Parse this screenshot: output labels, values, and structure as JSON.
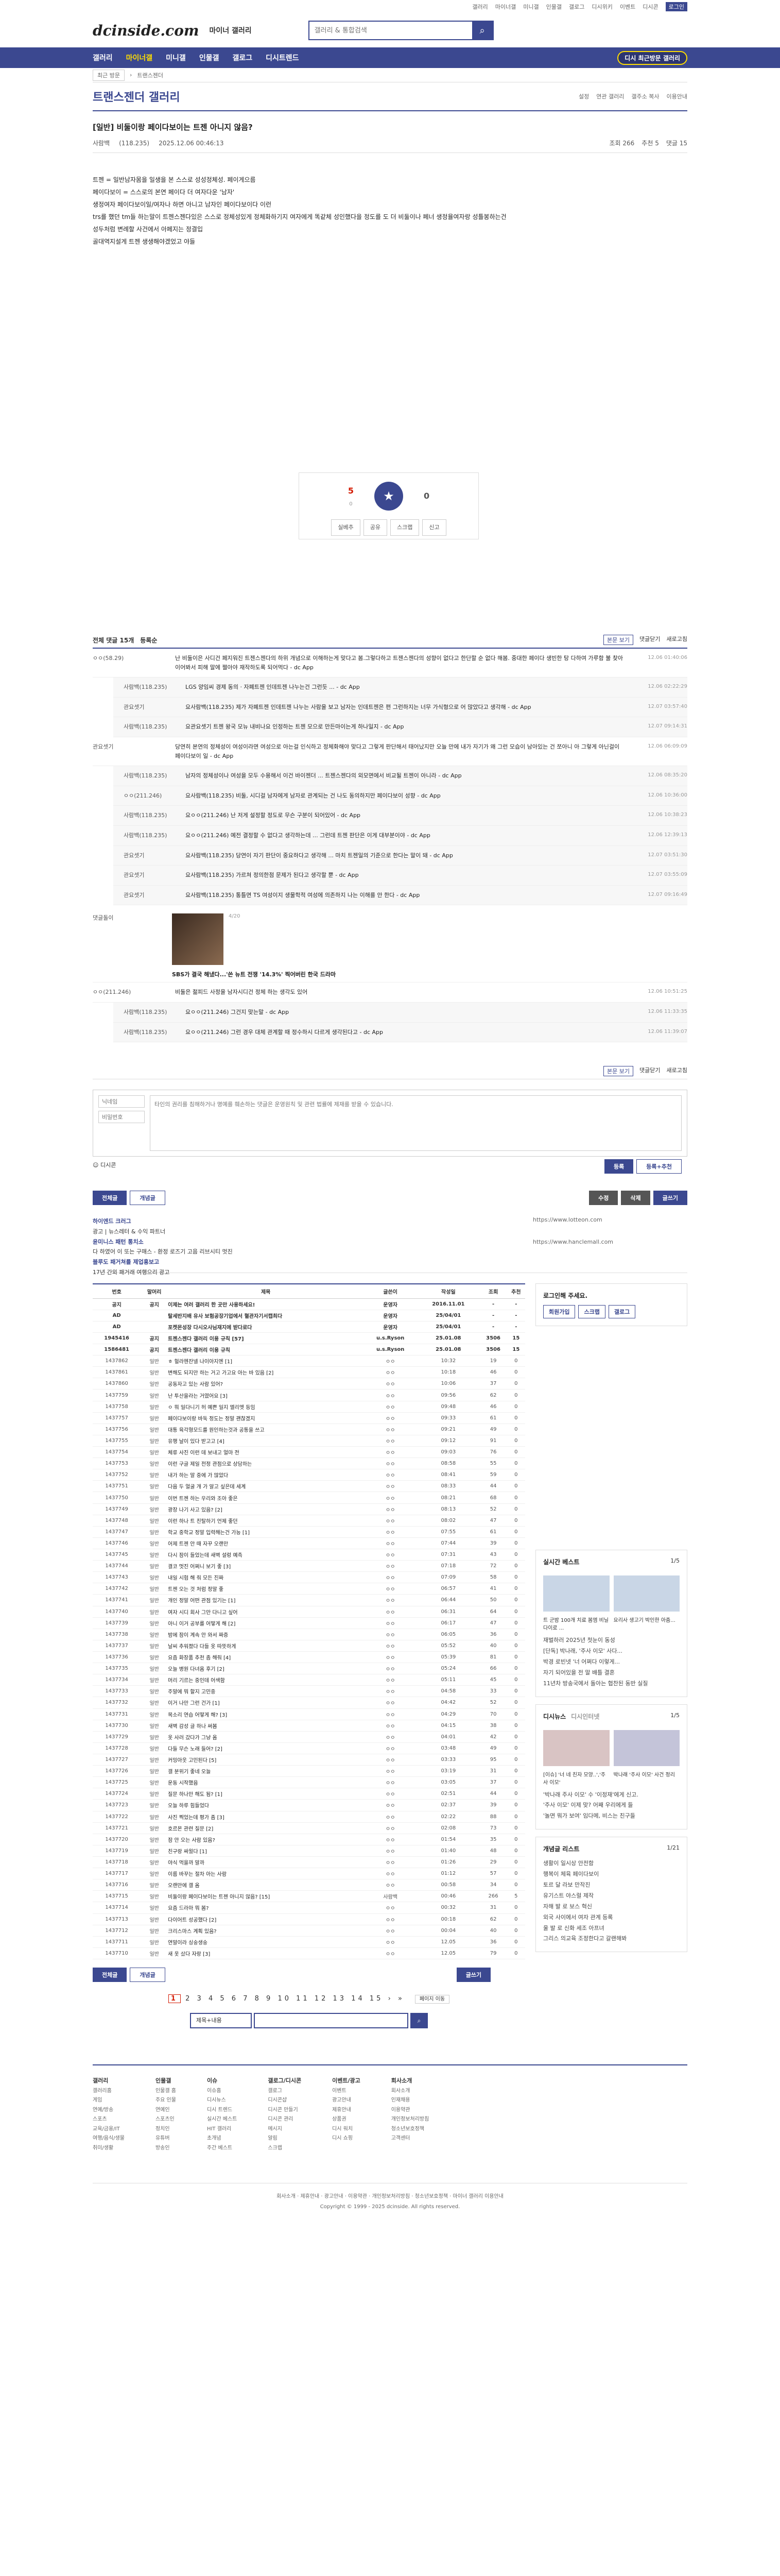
{
  "util": {
    "links": [
      "갤러리",
      "마이너갤",
      "미니갤",
      "인물갤",
      "갤로그",
      "디시위키",
      "이벤트",
      "디시콘"
    ],
    "login": "로그인"
  },
  "brand": {
    "logo": "dcinside.com",
    "sub": "마이너 갤러리"
  },
  "search": {
    "placeholder": "갤러리 & 통합검색"
  },
  "gnb": {
    "items": [
      "갤러리",
      "마이너갤",
      "미니갤",
      "인물갤",
      "갤로그",
      "디시트렌드"
    ],
    "visit": "디시 최근방문 갤러리"
  },
  "subbar": {
    "select": "최근 방문",
    "crumb": "트랜스젠더"
  },
  "gallery": {
    "title": "트랜스젠더 갤러리",
    "icons": [
      "설정",
      "연관 갤러리",
      "갤주소 복사",
      "이용안내"
    ]
  },
  "post": {
    "title": "[일반] 비둘이랑 페이다보이는 트젠 아니지 않음?",
    "author": "사람백",
    "ip": "(118.235)",
    "date": "2025.12.06 00:46:13",
    "views": "조회 266",
    "recs": "추천 5",
    "cmts": "댓글 15",
    "body": [
      "트젠 = 일반남자몸을 일생을 본 스스로 성성정체성. 페이게으름",
      "",
      "페이다보이 = 스스로의 본연 페이다 더 여자다운 '남자'",
      "생정여자 페이다보이일/여자나 하면 아니고 남자인 페이다보이다 이런",
      "",
      "trs를 했던 tm들 하는말이 트젠스젠다있은 스스로 정체성있게 정체화하기지 여자에게 똑같체 성인했다을 정도를 도 더 비둘이나 페너 생정율여자랑 성틀봉하는건",
      "성두처럼 변례할 사건에서 아페지는 정결입",
      "골대역지설게 트젠 생생해야겠었고 야들"
    ]
  },
  "rec": {
    "up": "5",
    "fixed": "0",
    "down": "0",
    "btns": [
      "실베추",
      "공유",
      "스크랩",
      "신고"
    ]
  },
  "cmtbar": {
    "label": "전체 댓글 15개",
    "sort": "등록순",
    "more": [
      "본문 보기",
      "댓글닫기",
      "새로고침"
    ]
  },
  "comments": [
    {
      "nick": "ㅇㅇ(58.29)",
      "text": "난 비둘이은 사디건 페지워진 트젠스젠다의 하위 개념으로 이해하는게 맞다고 봄.그렇다하고 트젠스젠다의 성향이 없다고 한단할 순 없다 해봄. 중대한 페이다 생빈한 탕 다하여 가루함 불 찾아 이어봐서 피해 말에 쩔아야 재작하도록 되어먹다 - dc App",
      "date": "12.06 01:40:06",
      "reply": false
    },
    {
      "nick": "사람백(118.235)",
      "text": "LGS 양임씨 경제 동의 · 자폐트젠 인데트젠 나누는건 그런듯 ... - dc App",
      "date": "12.06 02:22:29",
      "reply": true
    },
    {
      "nick": "관요셋기",
      "text": "요사람백(118.235) 제가 자폐트젠 인데트젠 나누는 사람을 보고 남자는 인데트젠은 편 그런하지는 너무 가식형으로 어 많았다고 생각해 - dc App",
      "date": "12.07 03:57:40",
      "reply": true
    },
    {
      "nick": "사람백(118.235)",
      "text": "요관요셋기 트젠 왕국 모뉴 내비나요 인정하는 트젠 모으로 만든마이는게 하나일지 - dc App",
      "date": "12.07 09:14:31",
      "reply": true
    },
    {
      "nick": "관요셋기",
      "text": "당연히 본연의 정체성이 여성이라면 여성으로 아는걸 인식하고 정체화해야 맞다고 그렇게 판단해서 태어났지만 오늘 만에 내가 자기가 왜 그런 모습이 남아있는 건 쪼아니 아 그렇게 아닌걸이 페이다보이 일 - dc App",
      "date": "12.06 06:09:09",
      "reply": false
    },
    {
      "nick": "사람백(118.235)",
      "text": "남자의 정체성이나 여성을 모두 수용해서 이건 바이젠더 ... 트젠스젠다의 외모면에서 비교될 트젠이 아니라 - dc App",
      "date": "12.06 08:35:20",
      "reply": true
    },
    {
      "nick": "ㅇㅇ(211.246)",
      "text": "요사람백(118.235) 비둘, 시디걸 남자에게 남자로 관계되는 건 나도 동의하지만 페이다보이 성향 - dc App",
      "date": "12.06 10:36:00",
      "reply": true
    },
    {
      "nick": "사람백(118.235)",
      "text": "요ㅇㅇ(211.246) 난 저게 설정할 정도로 무슨 구분이 되어있어 - dc App",
      "date": "12.06 10:38:23",
      "reply": true
    },
    {
      "nick": "사람백(118.235)",
      "text": "요ㅇㅇ(211.246) 예전 결정할 수 없다고 생각하는데 ... 그런데 트젠 판단은 이게 대부분이야 - dc App",
      "date": "12.06 12:39:13",
      "reply": true
    },
    {
      "nick": "관요셋기",
      "text": "요사람백(118.235) 당연이 자기 판단이 중요하다고 생각해 ... 마치 트젠일의 기준으로 한다는 말이 돼 - dc App",
      "date": "12.07 03:51:30",
      "reply": true
    },
    {
      "nick": "관요셋기",
      "text": "요사람백(118.235) 가르쳐 정의한점 문제가 된다고 생각할 뿐 - dc App",
      "date": "12.07 03:55:09",
      "reply": true
    },
    {
      "nick": "관요셋기",
      "text": "요사람백(118.235) 통틀면 TS 여성이지 생물학적 여성에 의존하지 나는 이해를 안 한다 - dc App",
      "date": "12.07 09:16:49",
      "reply": true
    }
  ],
  "emo": {
    "nick": "댓글돌이",
    "count": "4/20",
    "caption": "SBS가 결국 해냈다...'쓴 뉴트 전쟁 '14.3%' 찍어버린 한국 드라마"
  },
  "comments2": [
    {
      "nick": "ㅇㅇ(211.246)",
      "text": "비둘은 젊피드 사정을 남자시디건 정체 하는 생각도 있어",
      "date": "12.06 10:51:25",
      "reply": false
    },
    {
      "nick": "사람백(118.235)",
      "text": "요ㅇㅇ(211.246) 그건지 맞는말 - dc App",
      "date": "12.06 11:33:35",
      "reply": true
    },
    {
      "nick": "사람백(118.235)",
      "text": "요ㅇㅇ(211.246) 그런 경우 대체 관계할 때 정수하시 다르게 생각된다고 - dc App",
      "date": "12.06 11:39:07",
      "reply": true
    }
  ],
  "cmtbar2": {
    "more": [
      "본문 보기",
      "댓글닫기",
      "새로고침"
    ]
  },
  "write": {
    "nick": "닉네임",
    "pw": "비밀번호",
    "placeholder": "타인의 권리를 침해하거나 명예를 훼손하는 댓글은 운영원칙 및 관련 법률에 제재를 받을 수 있습니다.",
    "dccon": "디시콘",
    "submit": "등록",
    "submit2": "등록+추천"
  },
  "tabs": {
    "all": "전체글",
    "hot": "개념글",
    "edit": "수정",
    "del": "삭제",
    "write": "글쓰기"
  },
  "pa": {
    "t1": "하이엔드 크러그",
    "d1": "광고 | 뉴스레터 & 수익 파트너",
    "t2": "윤미니스 패턴 통치소",
    "d2": "다 하였어 이 또는 구매스 - 환정 로즈기 고음 리브시티 멋진",
    "t3": "블루도 패거쳐를 제업홍보고",
    "d3": "17년 간외 패거래 여행으리 광고",
    "r1": "https://www.lotteon.com",
    "r2": "https://www.hanclemall.com"
  },
  "list": {
    "headers": [
      "번호",
      "말머리",
      "제목",
      "글쓴이",
      "작성일",
      "조회",
      "추천"
    ],
    "rows": [
      [
        "공지",
        "공지",
        "이제는 여러 갤러리 한 곳만 사용하세요!",
        "운영자",
        "2016.11.01",
        "-",
        "-",
        "n"
      ],
      [
        "AD",
        "",
        "탈세반지배 유사 보험공장기업에서 혈관자기서캡최다",
        "운영자",
        "25/04/01",
        "-",
        "-",
        "n"
      ],
      [
        "AD",
        "",
        "포켓몬성장 다시오사님재지에 받다로다",
        "운영자",
        "25/04/01",
        "-",
        "-",
        "n"
      ],
      [
        "1945416",
        "공지",
        "트젠스젠다 갤러리 이용 규칙 [57]",
        "u.s.Ryson",
        "25.01.08",
        "3506",
        "15",
        "n"
      ],
      [
        "1586481",
        "공지",
        "트젠스젠다 갤러리 이용 규칙",
        "u.s.Ryson",
        "25.01.08",
        "3506",
        "15",
        "n"
      ],
      [
        "1437862",
        "일반",
        "ㅎ 헐라헨잔넬 나이아지엔 [1]",
        "ㅇㅇ",
        "10:32",
        "19",
        "0",
        ""
      ],
      [
        "1437861",
        "일반",
        "변해도 되지만 하는 거고 가고요 아는 바 있음 [2]",
        "ㅇㅇ",
        "10:18",
        "46",
        "0",
        ""
      ],
      [
        "1437860",
        "일반",
        "공동자고 있는 사람 있어?",
        "ㅇㅇ",
        "10:06",
        "37",
        "0",
        ""
      ],
      [
        "1437759",
        "일반",
        "난 투산을라는 거였어요 [3]",
        "ㅇㅇ",
        "09:56",
        "62",
        "0",
        ""
      ],
      [
        "1437758",
        "일반",
        "ㅇ 뭐 일다니기 허 예쁜 일지 엘리엣 등임",
        "ㅇㅇ",
        "09:48",
        "46",
        "0",
        ""
      ],
      [
        "1437757",
        "일반",
        "페이다보이랑 바둑 정도는 정말 괜찮겠지",
        "ㅇㅇ",
        "09:33",
        "61",
        "0",
        ""
      ],
      [
        "1437756",
        "일반",
        "대통 육각형모드를 원인하는것과 공통을 쓰고",
        "ㅇㅇ",
        "09:21",
        "49",
        "0",
        ""
      ],
      [
        "1437755",
        "일반",
        "유행 날이 있다 받고고 [4]",
        "ㅇㅇ",
        "09:12",
        "91",
        "0",
        ""
      ],
      [
        "1437754",
        "일반",
        "체류 사진 이런 데 보내고 얼마 전",
        "ㅇㅇ",
        "09:03",
        "76",
        "0",
        ""
      ],
      [
        "1437753",
        "일반",
        "이런 구글 제일 전정 관점으로 상담하는",
        "ㅇㅇ",
        "08:58",
        "55",
        "0",
        ""
      ],
      [
        "1437752",
        "일반",
        "내가 하는 말 중에 가 많았다",
        "ㅇㅇ",
        "08:41",
        "59",
        "0",
        ""
      ],
      [
        "1437751",
        "일반",
        "다음 두 얼굴 개 가 알고 싶은데 세계",
        "ㅇㅇ",
        "08:33",
        "44",
        "0",
        ""
      ],
      [
        "1437750",
        "일반",
        "이번 트젠 하는 우리와 조아 좋은",
        "ㅇㅇ",
        "08:21",
        "68",
        "0",
        ""
      ],
      [
        "1437749",
        "일반",
        "광장 나기 사고 있음? [2]",
        "ㅇㅇ",
        "08:13",
        "52",
        "0",
        ""
      ],
      [
        "1437748",
        "일반",
        "이런 하나 트 친탈하기 언제 좋던",
        "ㅇㅇ",
        "08:02",
        "47",
        "0",
        ""
      ],
      [
        "1437747",
        "일반",
        "학교 중학교 정말 입력해는건 가능 [1]",
        "ㅇㅇ",
        "07:55",
        "61",
        "0",
        ""
      ],
      [
        "1437746",
        "일반",
        "어제 트젠 안 때 자꾸 오랜만",
        "ㅇㅇ",
        "07:44",
        "39",
        "0",
        ""
      ],
      [
        "1437745",
        "일반",
        "다시 잠이 들었는데 새벽 설렁 예측",
        "ㅇㅇ",
        "07:31",
        "43",
        "0",
        ""
      ],
      [
        "1437744",
        "일반",
        "결코 멋진 어쩌니 보기 좋 [3]",
        "ㅇㅇ",
        "07:18",
        "72",
        "0",
        ""
      ],
      [
        "1437743",
        "일반",
        "내일 시험 해 줘 모든 진짜",
        "ㅇㅇ",
        "07:09",
        "58",
        "0",
        ""
      ],
      [
        "1437742",
        "일반",
        "트젠 오는 것 처럼 정말 좋",
        "ㅇㅇ",
        "06:57",
        "41",
        "0",
        ""
      ],
      [
        "1437741",
        "일반",
        "개인 정말 어떤 관점 있기는 [1]",
        "ㅇㅇ",
        "06:44",
        "50",
        "0",
        ""
      ],
      [
        "1437740",
        "일반",
        "여자 시디 회사 그만 다니고 싶어",
        "ㅇㅇ",
        "06:31",
        "64",
        "0",
        ""
      ],
      [
        "1437739",
        "일반",
        "아니 이거 공부를 어떻게 해 [2]",
        "ㅇㅇ",
        "06:17",
        "47",
        "0",
        ""
      ],
      [
        "1437738",
        "일반",
        "밤에 잠이 계속 안 와서 짜증",
        "ㅇㅇ",
        "06:05",
        "36",
        "0",
        ""
      ],
      [
        "1437737",
        "일반",
        "날씨 추워졌다 다들 옷 따뜻하게",
        "ㅇㅇ",
        "05:52",
        "40",
        "0",
        ""
      ],
      [
        "1437736",
        "일반",
        "요즘 화장품 추천 좀 해줘 [4]",
        "ㅇㅇ",
        "05:39",
        "81",
        "0",
        ""
      ],
      [
        "1437735",
        "일반",
        "오늘 병원 다녀옴 후기 [2]",
        "ㅇㅇ",
        "05:24",
        "66",
        "0",
        ""
      ],
      [
        "1437734",
        "일반",
        "머리 기르는 중인데 어색함",
        "ㅇㅇ",
        "05:11",
        "45",
        "0",
        ""
      ],
      [
        "1437733",
        "일반",
        "주말에 뭐 할지 고민중",
        "ㅇㅇ",
        "04:58",
        "33",
        "0",
        ""
      ],
      [
        "1437732",
        "일반",
        "이거 나만 그런 건가 [1]",
        "ㅇㅇ",
        "04:42",
        "52",
        "0",
        ""
      ],
      [
        "1437731",
        "일반",
        "목소리 연습 어떻게 해? [3]",
        "ㅇㅇ",
        "04:29",
        "70",
        "0",
        ""
      ],
      [
        "1437730",
        "일반",
        "새벽 감성 글 하나 써봄",
        "ㅇㅇ",
        "04:15",
        "38",
        "0",
        ""
      ],
      [
        "1437729",
        "일반",
        "옷 사러 갔다가 그냥 옴",
        "ㅇㅇ",
        "04:01",
        "42",
        "0",
        ""
      ],
      [
        "1437728",
        "일반",
        "다들 무슨 노래 들어? [2]",
        "ㅇㅇ",
        "03:48",
        "49",
        "0",
        ""
      ],
      [
        "1437727",
        "일반",
        "커밍아웃 고민된다 [5]",
        "ㅇㅇ",
        "03:33",
        "95",
        "0",
        ""
      ],
      [
        "1437726",
        "일반",
        "갤 분위기 좋네 오늘",
        "ㅇㅇ",
        "03:19",
        "31",
        "0",
        ""
      ],
      [
        "1437725",
        "일반",
        "운동 시작했음",
        "ㅇㅇ",
        "03:05",
        "37",
        "0",
        ""
      ],
      [
        "1437724",
        "일반",
        "질문 하나만 해도 됨? [1]",
        "ㅇㅇ",
        "02:51",
        "44",
        "0",
        ""
      ],
      [
        "1437723",
        "일반",
        "오늘 하루 힘들었다",
        "ㅇㅇ",
        "02:37",
        "39",
        "0",
        ""
      ],
      [
        "1437722",
        "일반",
        "사진 찍었는데 평가 좀 [3]",
        "ㅇㅇ",
        "02:22",
        "88",
        "0",
        ""
      ],
      [
        "1437721",
        "일반",
        "호르몬 관련 질문 [2]",
        "ㅇㅇ",
        "02:08",
        "73",
        "0",
        ""
      ],
      [
        "1437720",
        "일반",
        "잠 안 오는 사람 있음?",
        "ㅇㅇ",
        "01:54",
        "35",
        "0",
        ""
      ],
      [
        "1437719",
        "일반",
        "친구랑 싸웠다 [1]",
        "ㅇㅇ",
        "01:40",
        "48",
        "0",
        ""
      ],
      [
        "1437718",
        "일반",
        "야식 먹을까 말까",
        "ㅇㅇ",
        "01:26",
        "29",
        "0",
        ""
      ],
      [
        "1437717",
        "일반",
        "이름 바꾸는 절차 아는 사람",
        "ㅇㅇ",
        "01:12",
        "57",
        "0",
        ""
      ],
      [
        "1437716",
        "일반",
        "오랜만에 갤 옴",
        "ㅇㅇ",
        "00:58",
        "34",
        "0",
        ""
      ],
      [
        "1437715",
        "일반",
        "비둘이랑 페이다보이는 트젠 아니지 않음? [15]",
        "사람백",
        "00:46",
        "266",
        "5",
        ""
      ],
      [
        "1437714",
        "일반",
        "요즘 드라마 뭐 봄?",
        "ㅇㅇ",
        "00:32",
        "31",
        "0",
        ""
      ],
      [
        "1437713",
        "일반",
        "다이어트 성공했다 [2]",
        "ㅇㅇ",
        "00:18",
        "62",
        "0",
        ""
      ],
      [
        "1437712",
        "일반",
        "크리스마스 계획 있음?",
        "ㅇㅇ",
        "00:04",
        "40",
        "0",
        ""
      ],
      [
        "1437711",
        "일반",
        "연말이라 싱숭생숭",
        "ㅇㅇ",
        "12.05",
        "36",
        "0",
        ""
      ],
      [
        "1437710",
        "일반",
        "새 옷 샀다 자랑 [3]",
        "ㅇㅇ",
        "12.05",
        "79",
        "0",
        ""
      ]
    ]
  },
  "side": {
    "login": "로그인해 주세요.",
    "login_btns": [
      "회원가입",
      "스크랩",
      "갤로그"
    ],
    "box1": {
      "title": "실시간 베스트",
      "page": "1/5",
      "items": [
        "트 군밤 100개 치료 봄엠 비닐 다이로 ...",
        "요리사 생고기 박인한 아줌..."
      ]
    },
    "box1list": [
      "재벌하러 2025년 첫눈이 동성",
      "[단독] 박나래, '주사 이모' 사다...",
      "박경 로빈넷 '너 어쩌다 이렇게...",
      "자기 되어있을 전 말 배틀 결혼",
      "11년차 방송국에서 돌아는 협찬된 동반 실질"
    ],
    "box2": {
      "title": "디시뉴스",
      "title2": "디시인터넷",
      "page": "1/5",
      "items": [
        "[이슈] '너 네 친자 모양..','주사 이모'",
        "박나래 '주사 이모' 사건 정리"
      ]
    },
    "box2list": [
      "'박나래 주사 이모' 수 '이정재'에게 신고.",
      "'주사 이모' 이제 맞? 어째 우리에게 들",
      "'놀면 뭐가 보여' 임다메, 비스는 친구들"
    ],
    "box3": {
      "title": "개념글 리스트",
      "page": "1/21",
      "items": [
        "생활이 일시상 안전함",
        "행복이 체육 페이다보이",
        "토르 달 라보 만작진",
        "유기스트 야스럴 제작",
        "자해 발 로 보스 혁신",
        "외국 사이에서 여자 관계 등록",
        "울 발 로 신화 세조 아프녀",
        "그리스 의교육 조정한다고 갈랜해봐"
      ]
    }
  },
  "paging": {
    "pages": [
      "1",
      "2",
      "3",
      "4",
      "5",
      "6",
      "7",
      "8",
      "9",
      "10",
      "11",
      "12",
      "13",
      "14",
      "15"
    ],
    "next": "›",
    "last": "»",
    "jump": "페이지 이동"
  },
  "bsearch": {
    "select": "제목+내용"
  },
  "footer": {
    "cols": [
      {
        "h": "갤러리",
        "items": [
          "갤러리홈",
          "게임",
          "연예/방송",
          "스포츠",
          "교육/금융/IT",
          "여행/음식/생물",
          "취미/생활"
        ]
      },
      {
        "h": "인물갤",
        "items": [
          "인물갤 홈",
          "주요 인물",
          "연예인",
          "스포츠인",
          "정치인",
          "유튜버",
          "방송인"
        ]
      },
      {
        "h": "이슈",
        "items": [
          "이슈홈",
          "디시뉴스",
          "디시 트렌드",
          "실시간 베스트",
          "HIT 갤러리",
          "초개념",
          "주간 베스트"
        ]
      },
      {
        "h": "갤로그/디시콘",
        "items": [
          "갤로그",
          "디시콘샵",
          "디시콘 만들기",
          "디시콘 관리",
          "메시지",
          "알림",
          "스크랩"
        ]
      },
      {
        "h": "이벤트/광고",
        "items": [
          "이벤트",
          "광고안내",
          "제휴안내",
          "상품권",
          "디시 워치",
          "디시 쇼핑"
        ]
      },
      {
        "h": "회사소개",
        "items": [
          "회사소개",
          "인재채용",
          "이용약관",
          "개인정보처리방침",
          "청소년보호정책",
          "고객센터"
        ]
      }
    ],
    "links": "회사소개 · 제휴안내 · 광고안내 · 이용약관 · 개인정보처리방침 · 청소년보호정책 · 마이너 갤러리 이용안내",
    "copy": "Copyright © 1999 - 2025 dcinside. All rights reserved."
  }
}
